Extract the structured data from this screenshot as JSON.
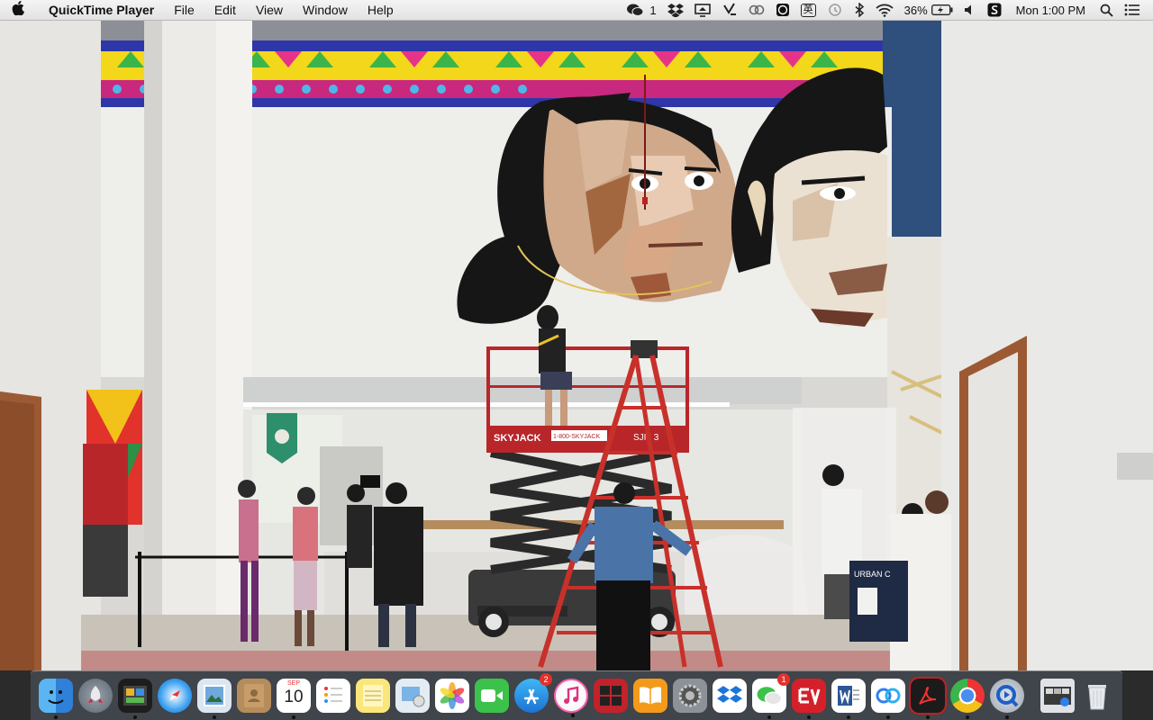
{
  "menubar": {
    "app_name": "QuickTime Player",
    "menus": [
      "File",
      "Edit",
      "View",
      "Window",
      "Help"
    ],
    "status": {
      "wechat_count": "1",
      "battery_percent": "36%",
      "clock": "Mon 1:00 PM",
      "input_method": "英"
    }
  },
  "video": {
    "lift_brand": "SKYJACK",
    "lift_model": "SJIII 3",
    "lift_phone": "1-800-SKYJACK",
    "sign_text": "URBAN C"
  },
  "dock": {
    "calendar": {
      "month": "SEP",
      "day": "10"
    },
    "badges": {
      "app_store": "2",
      "wechat": "1"
    }
  },
  "colors": {
    "menubar": "#eeeeee",
    "dock": "#4b505a",
    "badge": "#e0322d",
    "wall": "#eeeeeb",
    "lift": "#b8262a"
  }
}
